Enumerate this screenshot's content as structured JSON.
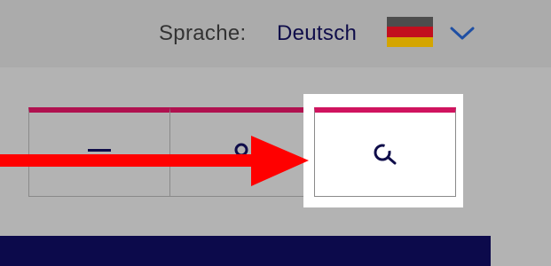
{
  "header": {
    "language_label": "Sprache:",
    "language_value": "Deutsch",
    "flag_icon": "germany-flag-icon",
    "dropdown_icon": "chevron-down-icon"
  },
  "nav": {
    "tabs": [
      {
        "icon": "menu-icon"
      },
      {
        "icon": "user-icon"
      },
      {
        "icon": "search-icon"
      }
    ]
  },
  "annotation": {
    "arrow_icon": "red-arrow-icon",
    "highlight": "search-tab-highlight"
  },
  "colors": {
    "accent_pink": "#b0114f",
    "navy": "#0c0a4b",
    "arrow_red": "#ff0000",
    "background": "#b3b3b3"
  }
}
